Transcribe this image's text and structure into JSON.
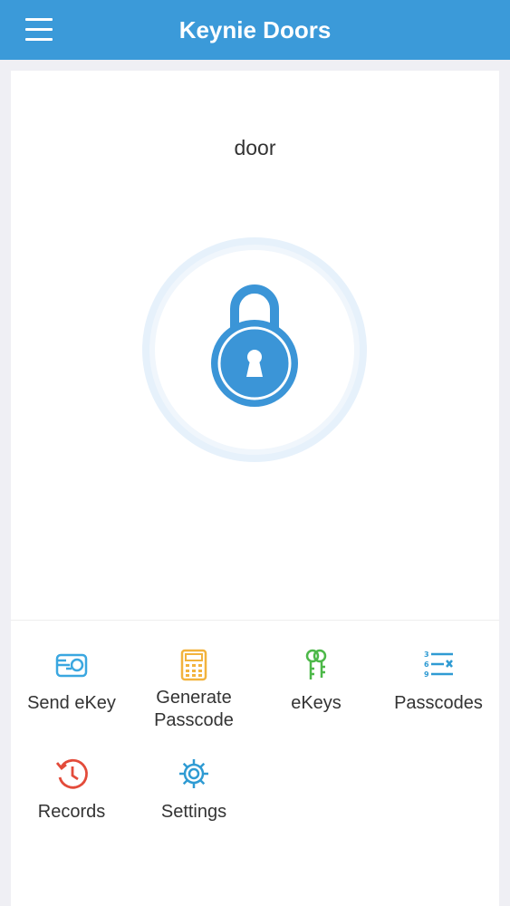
{
  "header": {
    "title": "Keynie Doors",
    "menu_icon": "hamburger-menu-icon"
  },
  "door": {
    "name": "door",
    "lock_icon": "padlock-icon"
  },
  "colors": {
    "header_bg": "#3b9ad9",
    "lock_blue": "#3b95d7",
    "send_ekey": "#3aa7e0",
    "passcode": "#f2b33d",
    "ekeys": "#4cb848",
    "passcodes": "#2f9bd3",
    "records": "#e34b3a",
    "settings": "#2f9bd3"
  },
  "actions": [
    {
      "label": "Send eKey",
      "icon": "send-ekey-icon"
    },
    {
      "label": "Generate Passcode",
      "icon": "calculator-icon"
    },
    {
      "label": "eKeys",
      "icon": "keys-icon"
    },
    {
      "label": "Passcodes",
      "icon": "passcode-list-icon"
    },
    {
      "label": "Records",
      "icon": "history-icon"
    },
    {
      "label": "Settings",
      "icon": "gear-icon"
    }
  ]
}
